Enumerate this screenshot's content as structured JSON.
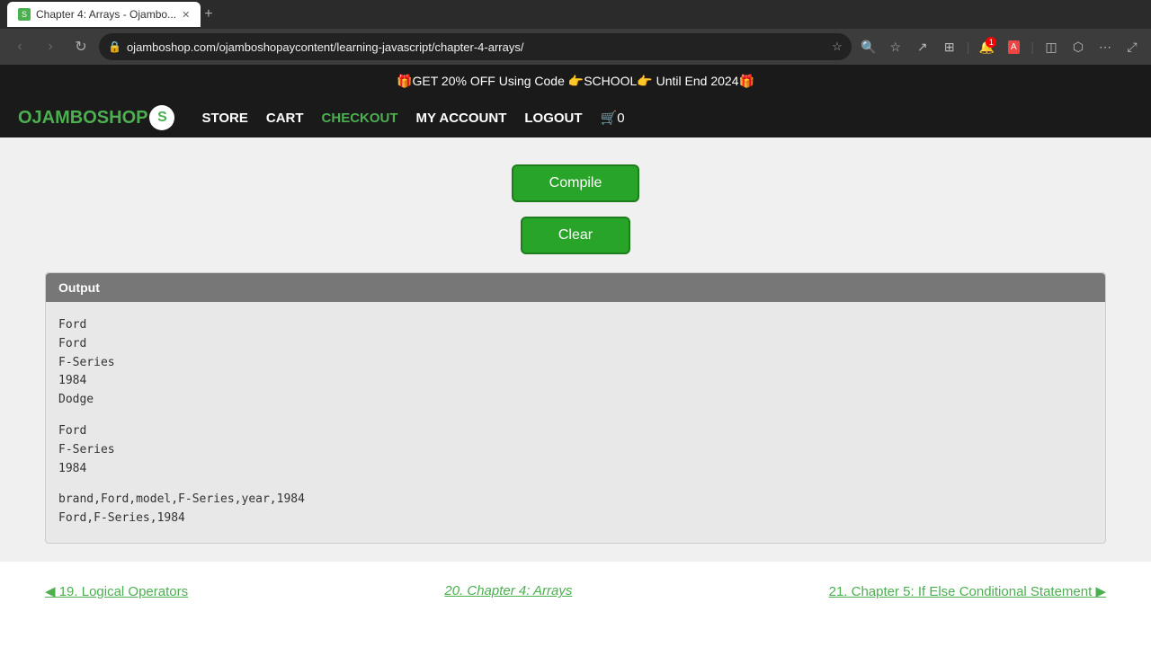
{
  "browser": {
    "tab_title": "Chapter 4: Arrays - Ojambo...",
    "tab_favicon": "S",
    "url": "ojamboshop.com/ojamboshopaycontent/learning-javascript/chapter-4-arrays/",
    "new_tab_label": "+",
    "back_btn": "‹",
    "forward_btn": "›",
    "reload_btn": "↻",
    "secure_icon": "🔒"
  },
  "promo": {
    "text": "🎁GET 20% OFF Using Code 👉SCHOOL👉 Until End 2024🎁"
  },
  "nav": {
    "logo": "OJAMBOSHOP",
    "logo_s": "S",
    "store": "STORE",
    "cart": "CART",
    "checkout": "CHECKOUT",
    "my_account": "MY ACCOUNT",
    "logout": "LOGOUT",
    "cart_count": "0"
  },
  "buttons": {
    "compile": "Compile",
    "clear": "Clear"
  },
  "output": {
    "header": "Output",
    "lines": [
      "Ford",
      "Ford",
      "F-Series",
      "1984",
      "Dodge",
      "",
      "Ford",
      "F-Series",
      "1984",
      "",
      "brand,Ford,model,F-Series,year,1984",
      "Ford,F-Series,1984"
    ]
  },
  "footer": {
    "prev_label": "19. Logical Operators",
    "current_label": "20. Chapter 4: Arrays",
    "next_label": "21. Chapter 5: If Else Conditional Statement"
  }
}
